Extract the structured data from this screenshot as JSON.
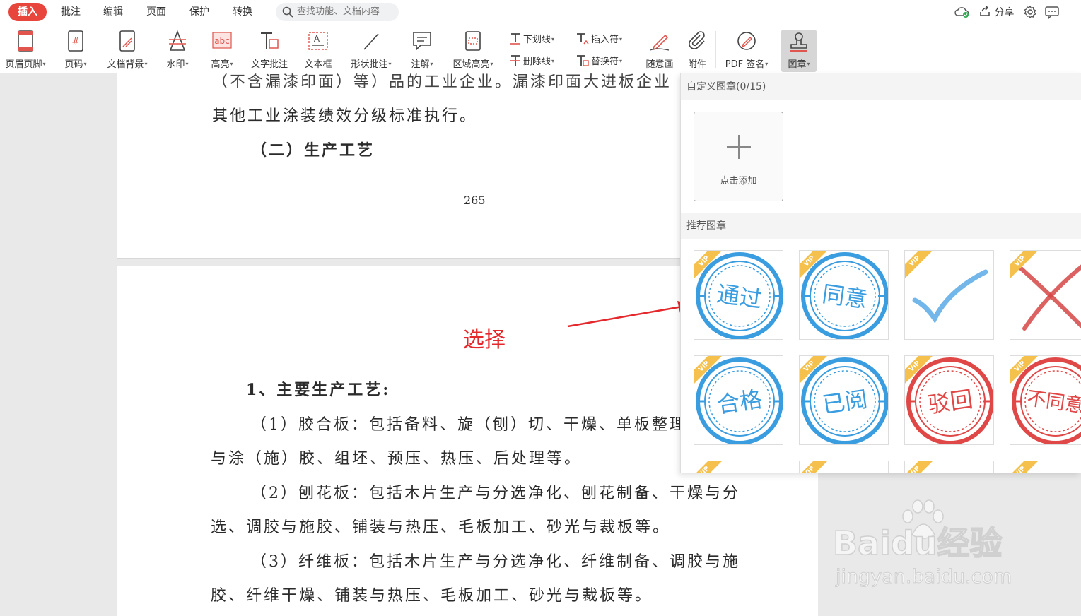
{
  "menu": {
    "tabs": [
      "插入",
      "批注",
      "编辑",
      "页面",
      "保护",
      "转换"
    ],
    "search_placeholder": "查找功能、文档内容",
    "share_label": "分享"
  },
  "ribbon": {
    "items": [
      "页眉页脚",
      "页码",
      "文档背景",
      "水印",
      "高亮",
      "文字批注",
      "文本框",
      "形状批注",
      "注解",
      "区域高亮",
      "随意画",
      "附件",
      "PDF 签名",
      "图章"
    ],
    "underline": "下划线",
    "strikethrough": "删除线",
    "insert_mark": "插入符",
    "replace_mark": "替换符"
  },
  "document": {
    "page1": {
      "line1": "（不含漏漆印面）等）品的工业企业。漏漆印面大进板企业",
      "line2": "其他工业涂装绩效分级标准执行。",
      "heading": "（二）生产工艺",
      "page_number": "265"
    },
    "page2": {
      "heading": "1、主要生产工艺:",
      "lines": [
        "（1）胶合板：包括备料、旋（刨）切、干燥、单板整理",
        "与涂（施）胶、组坯、预压、热压、后处理等。",
        "（2）刨花板：包括木片生产与分选净化、刨花制备、干燥与分",
        "选、调胶与施胶、铺装与热压、毛板加工、砂光与裁板等。",
        "（3）纤维板：包括木片生产与分选净化、纤维制备、调胶与施",
        "胶、纤维干燥、铺装与热压、毛板加工、砂光与裁板等。"
      ]
    },
    "annotation": "选择"
  },
  "stamp_panel": {
    "custom_header": "自定义图章(0/15)",
    "add_label": "点击添加",
    "recommended_header": "推荐图章",
    "vip_badge": "VIP",
    "stamps": [
      "通过",
      "同意",
      "已阅",
      "合格",
      "驳回",
      "不同意"
    ],
    "colors": {
      "blue": "#3a9de0",
      "red": "#e04848",
      "vip": "#f5c04c",
      "accent": "#e8453c"
    }
  },
  "watermark": {
    "brand": "Baidu经验",
    "url": "jingyan.baidu.com"
  }
}
